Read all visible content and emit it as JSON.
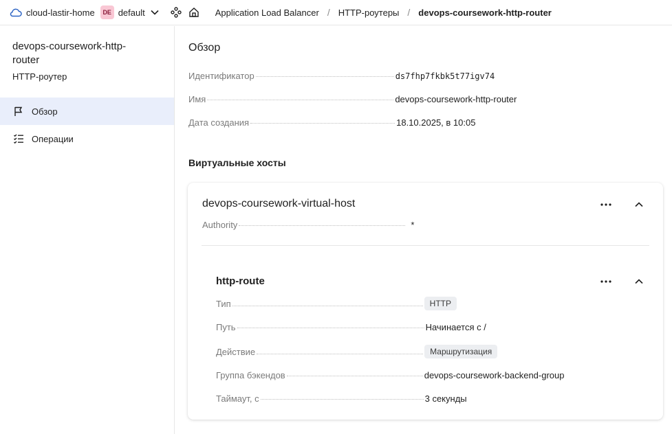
{
  "topbar": {
    "cloud_name": "cloud-lastir-home",
    "folder_badge": "DE",
    "folder_name": "default",
    "breadcrumbs": [
      "Application Load Balancer",
      "HTTP-роутеры",
      "devops-coursework-http-router"
    ],
    "separator": "/"
  },
  "sidebar": {
    "resource_title": "devops-coursework-http-router",
    "resource_type": "HTTP-роутер",
    "items": [
      {
        "label": "Обзор",
        "icon": "flag-icon",
        "active": true
      },
      {
        "label": "Операции",
        "icon": "list-check-icon",
        "active": false
      }
    ]
  },
  "overview": {
    "heading": "Обзор",
    "fields": [
      {
        "key": "Идентификатор",
        "value": "ds7fhp7fkbk5t77igv74"
      },
      {
        "key": "Имя",
        "value": "devops-coursework-http-router"
      },
      {
        "key": "Дата создания",
        "value": "18.10.2025, в 10:05"
      }
    ]
  },
  "vhosts": {
    "heading": "Виртуальные хосты",
    "host": {
      "name": "devops-coursework-virtual-host",
      "authority_key": "Authority",
      "authority_value": "*",
      "route": {
        "name": "http-route",
        "fields": [
          {
            "key": "Тип",
            "value": "HTTP"
          },
          {
            "key": "Путь",
            "value": "Начинается с /"
          },
          {
            "key": "Действие",
            "value": "Маршрутизация"
          },
          {
            "key": "Группа бэкендов",
            "value": "devops-coursework-backend-group"
          },
          {
            "key": "Таймаут, с",
            "value": "3 секунды"
          }
        ]
      }
    }
  },
  "colors": {
    "accent_link": "#2d64c4",
    "active_nav_bg": "#e9eefb",
    "badge_bg": "#f9c7d4"
  }
}
